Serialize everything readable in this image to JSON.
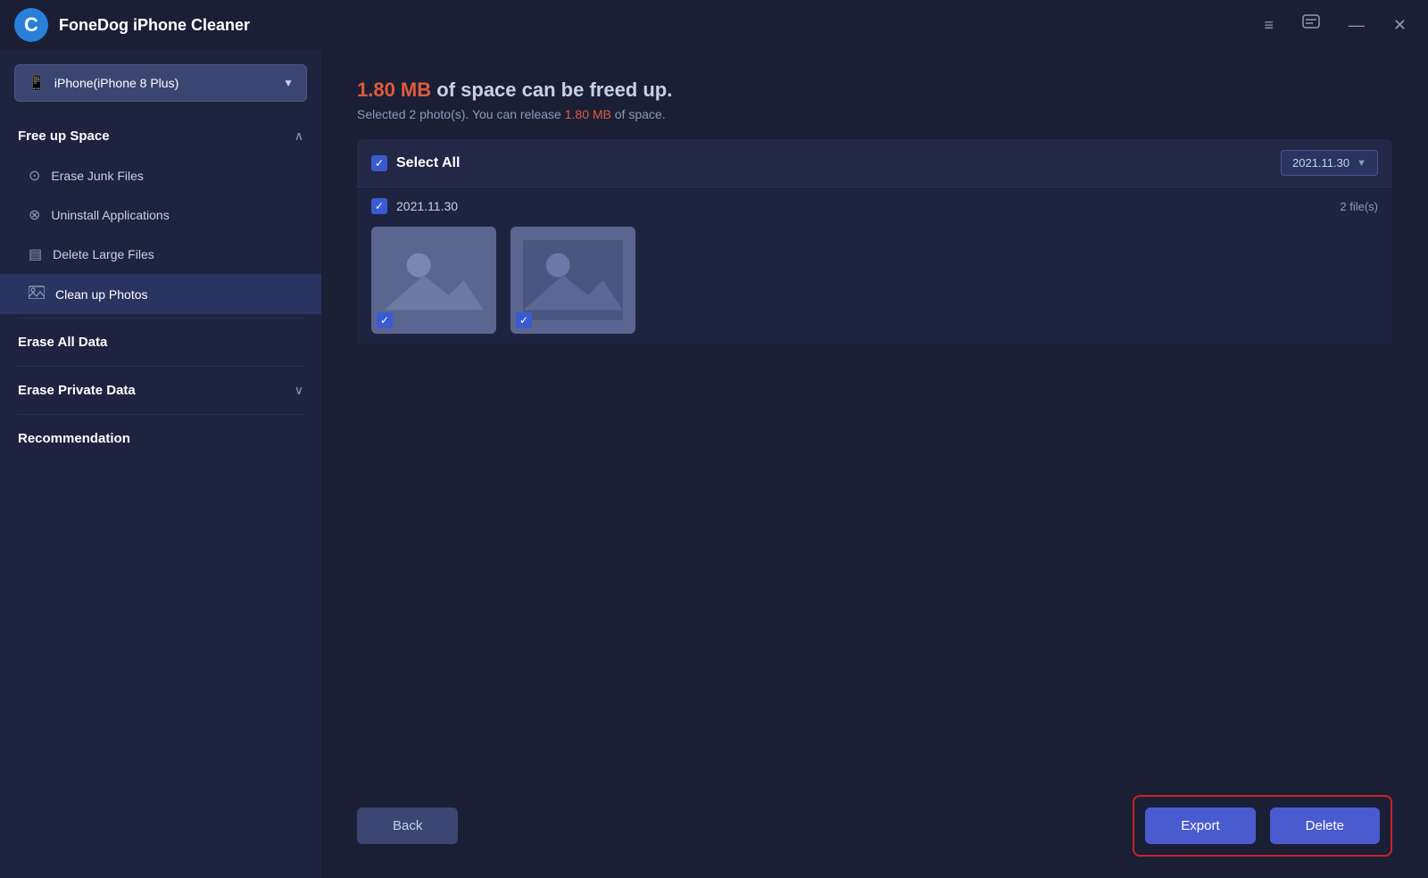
{
  "app": {
    "title": "FoneDog iPhone Cleaner",
    "logo_text": "C"
  },
  "titlebar": {
    "menu_icon": "≡",
    "chat_icon": "💬",
    "minimize_icon": "—",
    "close_icon": "✕"
  },
  "device": {
    "name": "iPhone(iPhone 8 Plus)",
    "icon": "📱"
  },
  "sidebar": {
    "free_up_space": {
      "label": "Free up Space",
      "expanded": true,
      "items": [
        {
          "label": "Erase Junk Files",
          "icon": "🕐"
        },
        {
          "label": "Uninstall Applications",
          "icon": "⊗"
        },
        {
          "label": "Delete Large Files",
          "icon": "▤"
        },
        {
          "label": "Clean up Photos",
          "icon": "🖼"
        }
      ]
    },
    "erase_all_data": {
      "label": "Erase All Data"
    },
    "erase_private_data": {
      "label": "Erase Private Data"
    },
    "recommendation": {
      "label": "Recommendation"
    }
  },
  "content": {
    "space_amount": "1.80 MB",
    "space_headline_suffix": " of space can be freed up.",
    "selected_count": "2",
    "selected_unit": "photo(s). You can release ",
    "release_amount": "1.80 MB",
    "release_suffix": " of space.",
    "select_all_label": "Select All",
    "date_label": "2021.11.30",
    "date_dropdown_value": "2021.11.30",
    "file_count": "2 file(s)",
    "photos": [
      {
        "id": 1,
        "checked": true
      },
      {
        "id": 2,
        "checked": true
      }
    ]
  },
  "buttons": {
    "back": "Back",
    "export": "Export",
    "delete": "Delete"
  }
}
